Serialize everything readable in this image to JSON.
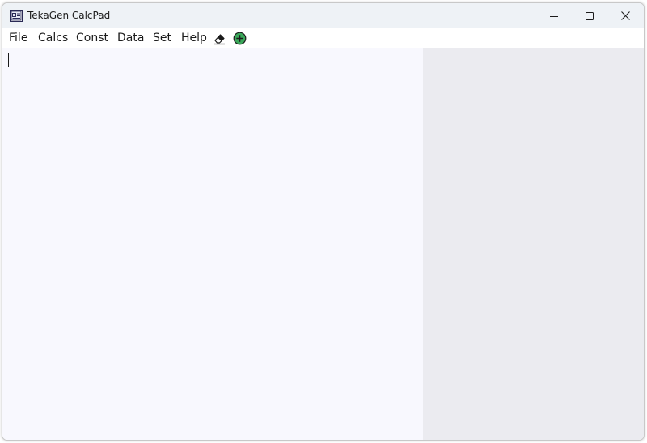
{
  "window": {
    "title": "TekaGen CalcPad",
    "app_icon": "calcpad-app-icon",
    "controls": {
      "minimize_icon": "minimize-icon",
      "maximize_icon": "maximize-icon",
      "close_icon": "close-icon"
    }
  },
  "menu": {
    "items": [
      {
        "label": "File"
      },
      {
        "label": "Calcs"
      },
      {
        "label": "Const"
      },
      {
        "label": "Data"
      },
      {
        "label": "Set"
      },
      {
        "label": "Help"
      }
    ],
    "tools": [
      {
        "icon": "eraser-icon"
      },
      {
        "icon": "add-circle-icon",
        "color": "#3aa75a"
      }
    ]
  },
  "editor": {
    "text": "",
    "background": "#f8f8fe"
  },
  "results": {
    "text": "",
    "background": "#ebebf0"
  },
  "colors": {
    "titlebar": "#eef2f6",
    "text": "#1b1b1b",
    "accent_green": "#3aa75a"
  }
}
